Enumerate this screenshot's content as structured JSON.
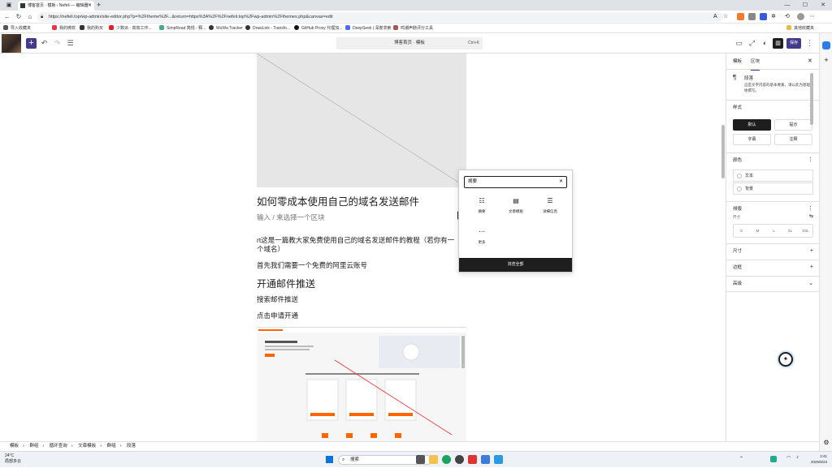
{
  "browser": {
    "tab_title": "博客首页 · 模板 ‹ Nefeli — 编辑器",
    "url": "https://nefeli.top/wp-admin/site-editor.php?p=%2Ftheme%2F...&return=https%3A%2F%2Fnefeli.top%2Fwp-admin%2Fthemes.php&canvas=edit",
    "bookmarks": [
      "导入收藏夹",
      "我的微软",
      "我的购买",
      "少数派 - 高效工作...",
      "SimpRead 简悦 - 释...",
      "WuWa Tracker",
      "DrawLink - Transfo...",
      "GitHub Proxy 代理加...",
      "DeepSeek | 深度求索",
      "鸣潮声骸评分工具"
    ],
    "other_bookmarks": "其他收藏夹"
  },
  "editor": {
    "doc_title": "博客首页 · 模板",
    "shortcut": "Ctrl+K",
    "save_label": "保存"
  },
  "canvas": {
    "heading1": "如何零成本使用自己的域名发送邮件",
    "placeholder": "输入 / 来选择一个区块",
    "para1": "rt这是一篇教大家免费使用自己的域名发送邮件的教程（若你有一",
    "para1b": "个域名）",
    "para2": "首先我们需要一个免费的阿里云账号",
    "heading2": "开通邮件推送",
    "para3": "搜索邮件推送",
    "para4": "点击申请开通"
  },
  "inserter": {
    "search_value": "摘要",
    "items": [
      {
        "label": "摘要",
        "icon": "excerpt-icon"
      },
      {
        "label": "文章模板",
        "icon": "post-template-icon"
      },
      {
        "label": "详细信息",
        "icon": "details-icon"
      },
      {
        "label": "更多",
        "icon": "more-icon"
      }
    ],
    "browse_all": "浏览全部"
  },
  "sidebar": {
    "tab_template": "模板",
    "tab_block": "区块",
    "block_title": "段落",
    "block_desc": "这是文字内容的基本要素，请以此为基础开始撰写。",
    "styles_heading": "样式",
    "styles": [
      "默认",
      "提示",
      "字幕",
      "注释"
    ],
    "color_heading": "颜色",
    "color_text": "文本",
    "color_bg": "背景",
    "typography_heading": "排版",
    "size_label": "尺寸",
    "sizes": [
      "S",
      "M",
      "L",
      "XL",
      "XXL"
    ],
    "dimensions_heading": "尺寸",
    "border_heading": "边框",
    "advanced_heading": "高级"
  },
  "breadcrumb": [
    "模板",
    "群组",
    "循环查询",
    "文章模板",
    "群组",
    "段落"
  ],
  "taskbar": {
    "temp": "24°C",
    "weather": "局部多云",
    "search": "搜索",
    "time": "2:41",
    "date": "2025/8/23"
  },
  "colors": {
    "accent": "#433a8b",
    "dark": "#1e1e1e"
  }
}
